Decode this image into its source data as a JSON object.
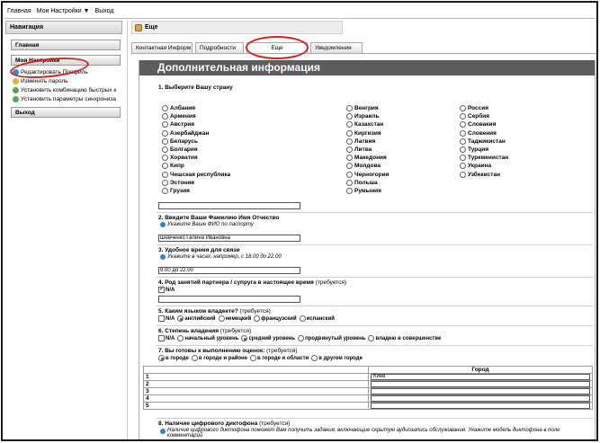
{
  "topbar": {
    "items": [
      "Главная",
      "Мои Настройки",
      "Выход"
    ],
    "settings_caret": "▼"
  },
  "sidebar": {
    "title": "Навигация",
    "home_button": "Главная",
    "settings_button": "Мои Настройки",
    "links": [
      "Редактировать Профиль",
      "Изменить пароль",
      "Установить комбинацию быстрых к",
      "Установить параметры синхрониза"
    ],
    "exit_button": "Выход"
  },
  "page": {
    "title": "Еще"
  },
  "tabs": [
    "Контактная Информ",
    "Подробности",
    "Еще",
    "Уведомления"
  ],
  "form": {
    "section_title": "Дополнительная информация",
    "q1": "1. Выберите Вашу страну",
    "countries": {
      "col1": [
        "Албания",
        "Армения",
        "Австрия",
        "Азербайджан",
        "Беларусь",
        "Болгария",
        "Хорватия",
        "Кипр",
        "Чешская республика",
        "Эстония",
        "Грузия"
      ],
      "col2": [
        "Венгрия",
        "Израиль",
        "Казахстан",
        "Киргизия",
        "Латвия",
        "Литва",
        "Македония",
        "Молдова",
        "Черногория",
        "Польша",
        "Румыния"
      ],
      "col3": [
        "Россия",
        "Сербия",
        "Словакия",
        "Словения",
        "Таджикистан",
        "Турция",
        "Туркменистан",
        "Украина",
        "Узбекистан"
      ]
    },
    "q2": "2. Введите Ваши Фамилию Имя Отчество",
    "q2_hint": "Укажите Ваше ФИО по паспорту",
    "q2_value": "Шевченко Галина Ивановна",
    "q3": "3. Удобное время для связи",
    "q3_hint": "Укажите в часах, например, с 18.00 до 22.00",
    "q3_value": "9.00 до 22.00",
    "q4": "4. Род занятий партнера / супруга в настоящее время",
    "q4_req": "(требуется)",
    "q4_na": "N/A",
    "q5": "5. Каким языком владеете?",
    "q5_req": "(требуется)",
    "q5_na": "N/A",
    "q5_options": [
      "английский",
      "немецкий",
      "французский",
      "испанский"
    ],
    "q6": "6. Степень владения",
    "q6_req": "(требуется)",
    "q6_na": "N/A",
    "q6_options": [
      "начальный уровень",
      "средний уровень",
      "продвинутый уровень",
      "владею в совершенстве"
    ],
    "q7": "7. Вы готовы к выполнению оценок:",
    "q7_req": "(требуется)",
    "q7_options": [
      "в городе",
      "в городе и районе",
      "в городе и области",
      "в другом городе"
    ],
    "city_header": "Город",
    "city_rows": [
      {
        "num": "1",
        "value": "Киев"
      },
      {
        "num": "2",
        "value": ""
      },
      {
        "num": "3",
        "value": ""
      },
      {
        "num": "4",
        "value": ""
      },
      {
        "num": "5",
        "value": ""
      }
    ],
    "q8": "8. Наличие цифрового диктофона",
    "q8_req": "(требуется)",
    "q8_hint": "Наличие цифрового диктофона поможет Вам получить задания, включающие скрытую аудиозапись обслуживания. Укажите модель диктофона в поле комментарий"
  },
  "colors": {
    "annotation": "#d51f1f",
    "section_bar": "#5d5d5d",
    "radio_selected": "#1f5ea8"
  }
}
